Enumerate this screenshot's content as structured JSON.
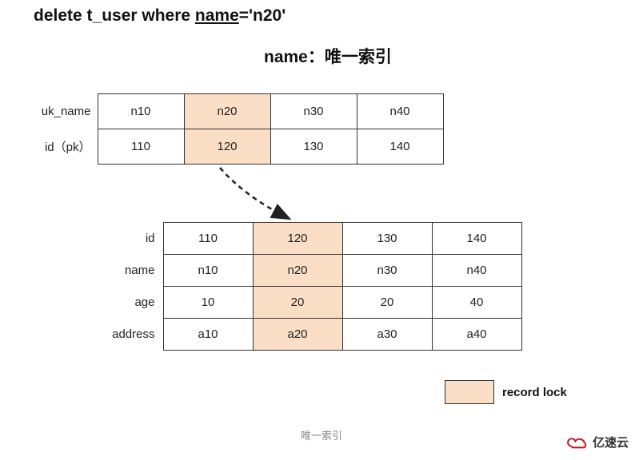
{
  "sql": {
    "prefix": "delete t_user where ",
    "underlined": "name",
    "suffix": "='n20'"
  },
  "index_title": "name：唯一索引",
  "top_table": {
    "row_labels": [
      "uk_name",
      "id（pk）"
    ],
    "data": [
      [
        "n10",
        "n20",
        "n30",
        "n40"
      ],
      [
        "110",
        "120",
        "130",
        "140"
      ]
    ],
    "highlighted_col": 1
  },
  "bottom_table": {
    "row_labels": [
      "id",
      "name",
      "age",
      "address"
    ],
    "data": [
      [
        "110",
        "120",
        "130",
        "140"
      ],
      [
        "n10",
        "n20",
        "n30",
        "n40"
      ],
      [
        "10",
        "20",
        "20",
        "40"
      ],
      [
        "a10",
        "a20",
        "a30",
        "a40"
      ]
    ],
    "highlighted_col": 1
  },
  "legend_label": "record lock",
  "caption": "唯一索引",
  "logo_text": "亿速云",
  "colors": {
    "highlight": "#fadec5"
  }
}
